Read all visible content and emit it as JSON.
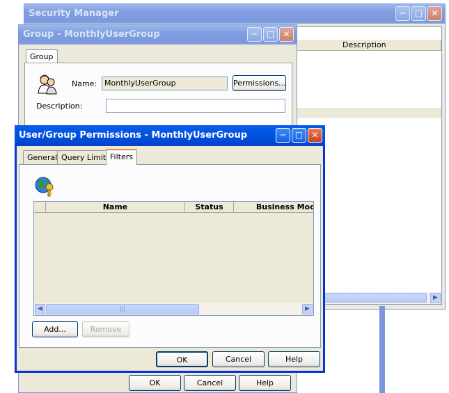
{
  "security_manager": {
    "title": "Security Manager",
    "columns": [
      "Description"
    ]
  },
  "group_dialog": {
    "title": "Group - MonthlyUserGroup",
    "tab": "Group",
    "name_label": "Name:",
    "name_value": "MonthlyUserGroup",
    "permissions_button": "Permissions...",
    "description_label": "Description:",
    "description_value": "",
    "ok": "OK",
    "cancel": "Cancel",
    "help": "Help"
  },
  "permissions_dialog": {
    "title": "User/Group Permissions - MonthlyUserGroup",
    "tabs": [
      "General",
      "Query Limits",
      "Filters"
    ],
    "active_tab": "Filters",
    "columns": [
      "Name",
      "Status",
      "Business Mod"
    ],
    "add_button": "Add...",
    "remove_button": "Remove",
    "ok": "OK",
    "cancel": "Cancel",
    "help": "Help"
  }
}
